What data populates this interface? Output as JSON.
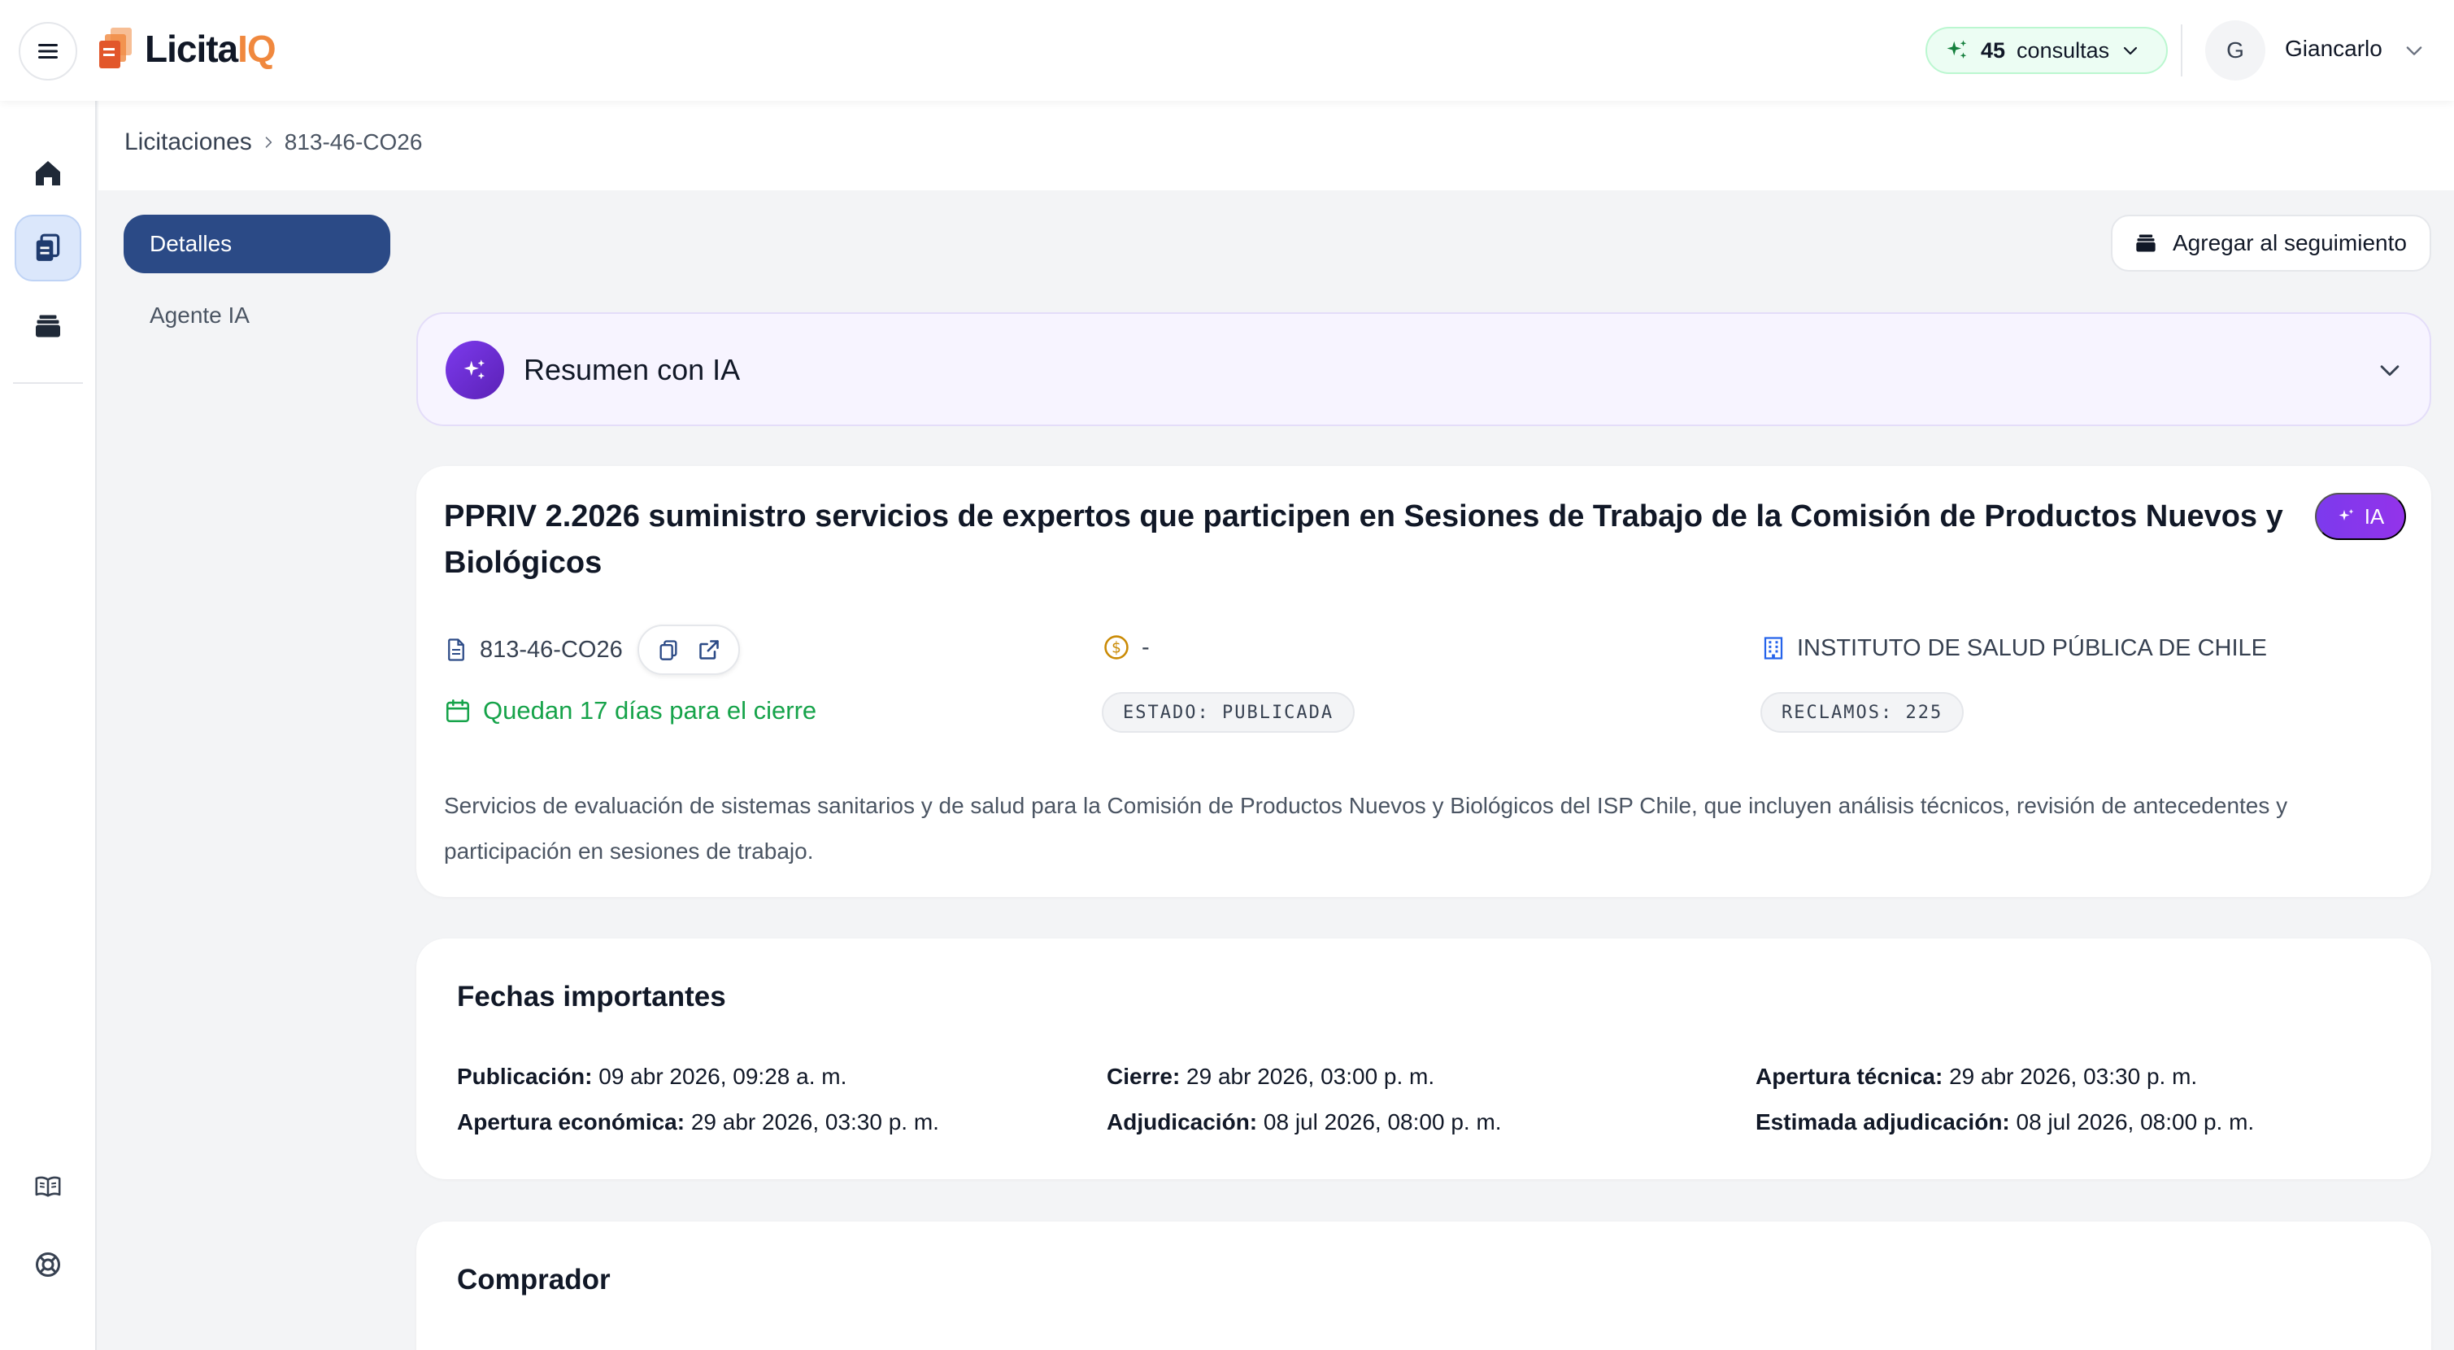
{
  "brand": {
    "logo_dark": "Licita",
    "logo_accent": "IQ"
  },
  "header": {
    "credits_count": "45",
    "credits_label": "consultas",
    "avatar_initial": "G",
    "user_name": "Giancarlo"
  },
  "sidebar": {
    "items": [
      {
        "icon": "home-icon",
        "active": false
      },
      {
        "icon": "clipboard-icon",
        "active": true
      },
      {
        "icon": "archive-icon",
        "active": false
      }
    ],
    "bottom_items": [
      {
        "icon": "book-icon"
      },
      {
        "icon": "help-lifebuoy-icon"
      }
    ]
  },
  "breadcrumb": {
    "parent": "Licitaciones",
    "current": "813-46-CO26"
  },
  "subnav": {
    "active_tab": "Detalles",
    "other_tab": "Agente IA"
  },
  "actions": {
    "follow_label": "Agregar al seguimiento"
  },
  "ai_summary": {
    "title": "Resumen con IA"
  },
  "tender": {
    "title": "PPRIV 2.2026 suministro servicios de expertos que participen en Sesiones de Trabajo de la Comisión de Productos Nuevos y Biológicos",
    "ia_badge": "IA",
    "code": "813-46-CO26",
    "amount": "-",
    "buyer_org": "INSTITUTO DE SALUD PÚBLICA DE CHILE",
    "deadline_text": "Quedan 17 días para el cierre",
    "status_chip": "ESTADO: PUBLICADA",
    "claims_chip": "RECLAMOS: 225",
    "description": "Servicios de evaluación de sistemas sanitarios y de salud para la Comisión de Productos Nuevos y Biológicos del ISP Chile, que incluyen análisis técnicos, revisión de antecedentes y participación en sesiones de trabajo."
  },
  "dates": {
    "title": "Fechas importantes",
    "items": [
      {
        "label": "Publicación:",
        "value": "09 abr 2026, 09:28 a. m."
      },
      {
        "label": "Cierre:",
        "value": "29 abr 2026, 03:00 p. m."
      },
      {
        "label": "Apertura técnica:",
        "value": "29 abr 2026, 03:30 p. m."
      },
      {
        "label": "Apertura económica:",
        "value": "29 abr 2026, 03:30 p. m."
      },
      {
        "label": "Adjudicación:",
        "value": "08 jul 2026, 08:00 p. m."
      },
      {
        "label": "Estimada adjudicación:",
        "value": "08 jul 2026, 08:00 p. m."
      }
    ]
  },
  "buyer_section": {
    "title": "Comprador"
  },
  "colors": {
    "primary": "#2b4a86",
    "accent_orange": "#f0883e",
    "ai_purple": "#7c3aed",
    "success_green": "#16a34a"
  }
}
